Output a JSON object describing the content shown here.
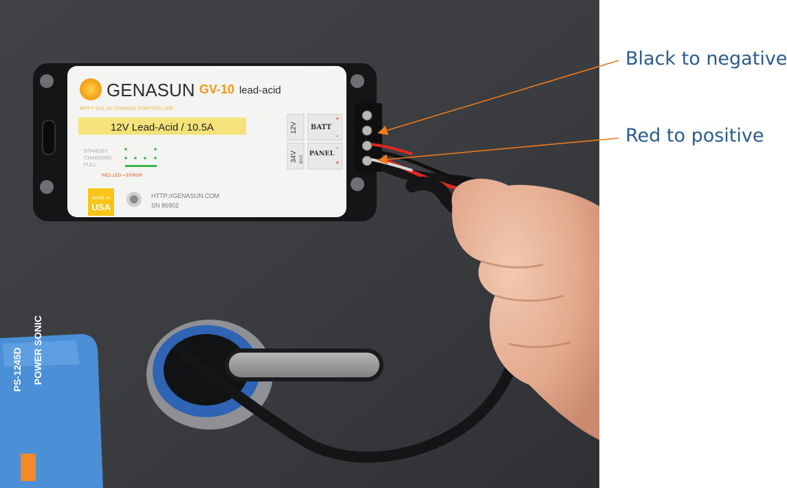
{
  "callouts": {
    "black": "Black to negative",
    "red": "Red to positive"
  },
  "device": {
    "brand": "GENASUN",
    "model": "GV-10",
    "chemistry": "lead-acid",
    "subtitle": "MPPT SOLAR CHARGE CONTROLLER",
    "rating": "12V Lead-Acid / 10.5A",
    "status_labels": [
      "STANDBY",
      "CHARGING",
      "FULL"
    ],
    "error_note": "RED LED = ERROR",
    "url": "HTTP://GENASUN.COM",
    "serial": "SN 86902",
    "made_in": [
      "MADE IN",
      "USA"
    ],
    "batt_voltage": "12V",
    "batt_label": "BATT",
    "panel_voltage": "34V",
    "panel_voltage_note": "MAX",
    "panel_label": "PANEL",
    "plus_sign": "+",
    "minus_sign": "-"
  },
  "battery": {
    "brand": "POWER SONIC",
    "model": "PS-1245D"
  },
  "colors": {
    "callout_text": "#2a5b8c",
    "arrow": "#f07a1e",
    "wall": "#3a3c40",
    "label_yellow": "#f6e27a",
    "battery_blue": "#4b8fd6"
  }
}
